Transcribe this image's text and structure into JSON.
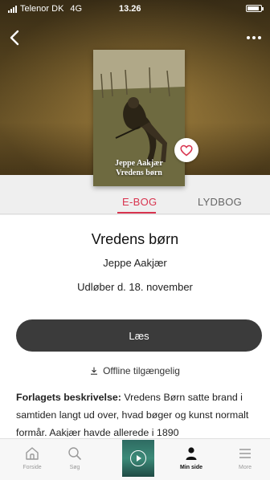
{
  "status_bar": {
    "carrier": "Telenor DK",
    "network": "4G",
    "time": "13.26"
  },
  "book": {
    "cover_title_line1": "Jeppe Aakjær",
    "cover_title_line2": "Vredens børn",
    "title": "Vredens børn",
    "author": "Jeppe Aakjær",
    "expiry": "Udløber d. 18. november",
    "is_favorite": false
  },
  "tabs": [
    {
      "label": "E-BOG",
      "active": true
    },
    {
      "label": "LYDBOG",
      "active": false
    }
  ],
  "actions": {
    "read_label": "Læs",
    "offline_label": "Offline tilgængelig"
  },
  "description": {
    "label": "Forlagets beskrivelse:",
    "text": "Vredens Børn satte brand i samtiden langt ud over, hvad bøger og kunst normalt formår. Aakjær havde allerede i 1890"
  },
  "bottom_nav": [
    {
      "label": "Forside",
      "icon": "home-icon",
      "active": false
    },
    {
      "label": "Søg",
      "icon": "search-icon",
      "active": false
    },
    {
      "label": "Min side",
      "icon": "person-icon",
      "active": true
    },
    {
      "label": "More",
      "icon": "menu-icon",
      "active": false
    }
  ],
  "colors": {
    "accent": "#d8344f",
    "button": "#3b3b3b",
    "tab_background": "#efefef"
  }
}
